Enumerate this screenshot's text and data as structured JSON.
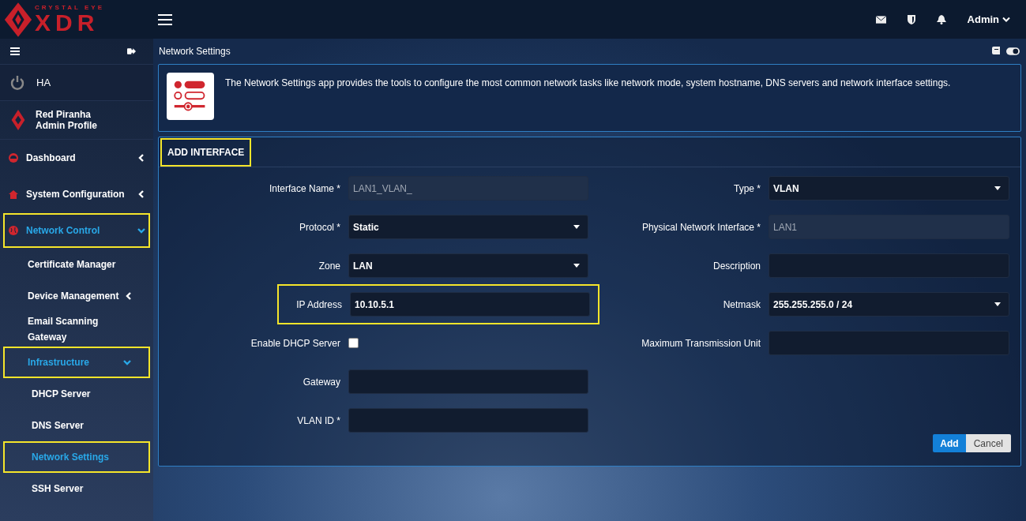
{
  "logo": {
    "tagline": "CRYSTAL EYE",
    "wordmark": "XDR"
  },
  "topbar": {
    "user": "Admin"
  },
  "sidebar": {
    "ha_label": "HA",
    "profile": {
      "name": "Red Piranha",
      "role": "Admin Profile"
    },
    "items": [
      {
        "label": "Dashboard",
        "selected": false,
        "expanded": false,
        "highlighted": false
      },
      {
        "label": "System Configuration",
        "selected": false,
        "expanded": false,
        "highlighted": false
      },
      {
        "label": "Network Control",
        "selected": true,
        "expanded": true,
        "highlighted": true,
        "children": [
          {
            "label": "Certificate Manager",
            "selected": false,
            "highlighted": false
          },
          {
            "label": "Device Management",
            "selected": false,
            "highlighted": false,
            "expanded": false
          },
          {
            "label": "Email Scanning Gateway",
            "selected": false,
            "highlighted": false
          },
          {
            "label": "Infrastructure",
            "selected": true,
            "highlighted": true,
            "expanded": true,
            "children": [
              {
                "label": "DHCP Server",
                "selected": false,
                "highlighted": false
              },
              {
                "label": "DNS Server",
                "selected": false,
                "highlighted": false
              },
              {
                "label": "Network Settings",
                "selected": true,
                "highlighted": true
              },
              {
                "label": "SSH Server",
                "selected": false,
                "highlighted": false
              }
            ]
          }
        ]
      }
    ]
  },
  "page": {
    "title": "Network Settings",
    "intro": "The Network Settings app provides the tools to configure the most common network tasks like network mode, system hostname, DNS servers and network interface settings."
  },
  "form": {
    "title": "ADD INTERFACE",
    "title_highlighted": true,
    "left": [
      {
        "label": "Interface Name *",
        "kind": "text",
        "value": "LAN1_VLAN_",
        "disabled": true,
        "highlighted": false
      },
      {
        "label": "Protocol *",
        "kind": "select",
        "value": "Static",
        "disabled": false,
        "highlighted": false
      },
      {
        "label": "Zone",
        "kind": "select",
        "value": "LAN",
        "disabled": false,
        "highlighted": false
      },
      {
        "label": "IP Address",
        "kind": "text",
        "value": "10.10.5.1",
        "disabled": false,
        "highlighted": true
      },
      {
        "label": "Enable DHCP Server",
        "kind": "checkbox",
        "checked": false,
        "highlighted": false
      },
      {
        "label": "Gateway",
        "kind": "text",
        "disabled": false,
        "highlighted": false
      },
      {
        "label": "VLAN ID *",
        "kind": "text",
        "disabled": false,
        "highlighted": false
      }
    ],
    "right": [
      {
        "label": "Type *",
        "kind": "select",
        "value": "VLAN",
        "disabled": false,
        "highlighted": false
      },
      {
        "label": "Physical Network Interface *",
        "kind": "text",
        "value": "LAN1",
        "disabled": true,
        "highlighted": false
      },
      {
        "label": "Description",
        "kind": "text",
        "disabled": false,
        "highlighted": false
      },
      {
        "label": "Netmask",
        "kind": "select",
        "value": "255.255.255.0 / 24",
        "disabled": false,
        "highlighted": false
      },
      {
        "label": "Maximum Transmission Unit",
        "kind": "text",
        "disabled": false,
        "highlighted": false
      }
    ],
    "buttons": [
      {
        "label": "Add",
        "kind": "primary"
      },
      {
        "label": "Cancel",
        "kind": "secondary"
      }
    ]
  }
}
